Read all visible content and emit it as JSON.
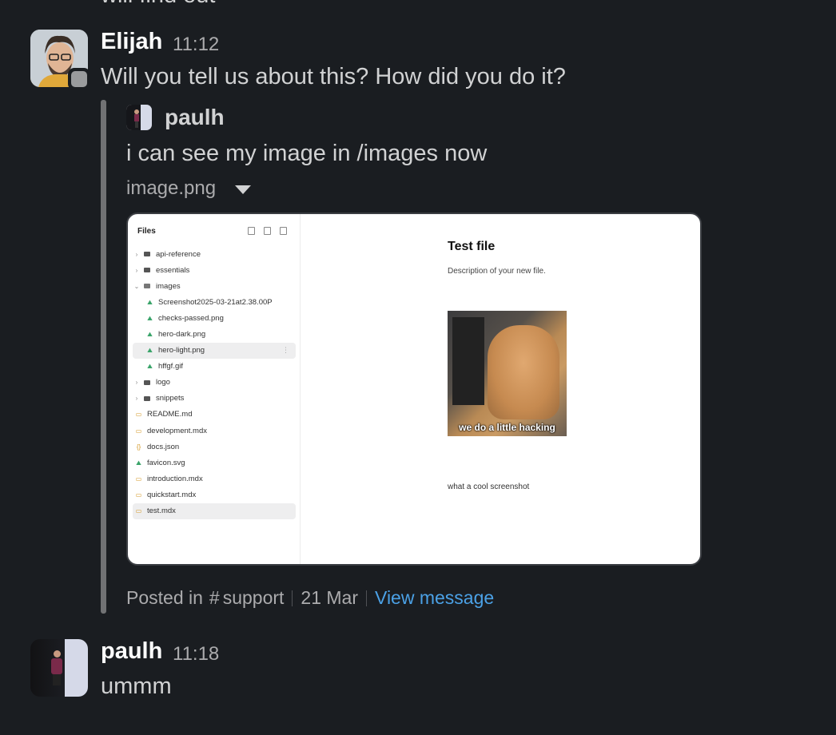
{
  "previous_message_tail": "will find out",
  "messages": [
    {
      "author": "Elijah",
      "time": "11:12",
      "text": "Will you tell us about this? How did you do it?",
      "shared": {
        "author": "paulh",
        "text": "i can see my image in /images now",
        "file_name": "image.png",
        "footer": {
          "posted_in_label": "Posted in",
          "channel_hash": "#",
          "channel": "support",
          "date": "21 Mar",
          "view_label": "View message"
        }
      }
    },
    {
      "author": "paulh",
      "time": "11:18",
      "text": "ummm"
    }
  ],
  "screenshot": {
    "sidebar_title": "Files",
    "tree": [
      {
        "label": "api-reference",
        "kind": "folder",
        "chevron": "›"
      },
      {
        "label": "essentials",
        "kind": "folder",
        "chevron": "›"
      },
      {
        "label": "images",
        "kind": "folder-open",
        "chevron": "⌄"
      },
      {
        "label": "Screenshot2025-03-21at2.38.00P",
        "kind": "image"
      },
      {
        "label": "checks-passed.png",
        "kind": "image"
      },
      {
        "label": "hero-dark.png",
        "kind": "image"
      },
      {
        "label": "hero-light.png",
        "kind": "image"
      },
      {
        "label": "hffgf.gif",
        "kind": "image"
      },
      {
        "label": "logo",
        "kind": "folder",
        "chevron": "›"
      },
      {
        "label": "snippets",
        "kind": "folder",
        "chevron": "›"
      },
      {
        "label": "README.md",
        "kind": "doc"
      },
      {
        "label": "development.mdx",
        "kind": "doc"
      },
      {
        "label": "docs.json",
        "kind": "json"
      },
      {
        "label": "favicon.svg",
        "kind": "image"
      },
      {
        "label": "introduction.mdx",
        "kind": "doc"
      },
      {
        "label": "quickstart.mdx",
        "kind": "doc"
      },
      {
        "label": "test.mdx",
        "kind": "doc"
      }
    ],
    "doc_title": "Test file",
    "doc_description": "Description of your new file.",
    "image_caption": "we do a little hacking",
    "doc_footer": "what a cool screenshot"
  },
  "colors": {
    "background": "#1a1d21",
    "link": "#4ba1e6",
    "text": "#d1d2d3",
    "muted": "#ababad"
  }
}
